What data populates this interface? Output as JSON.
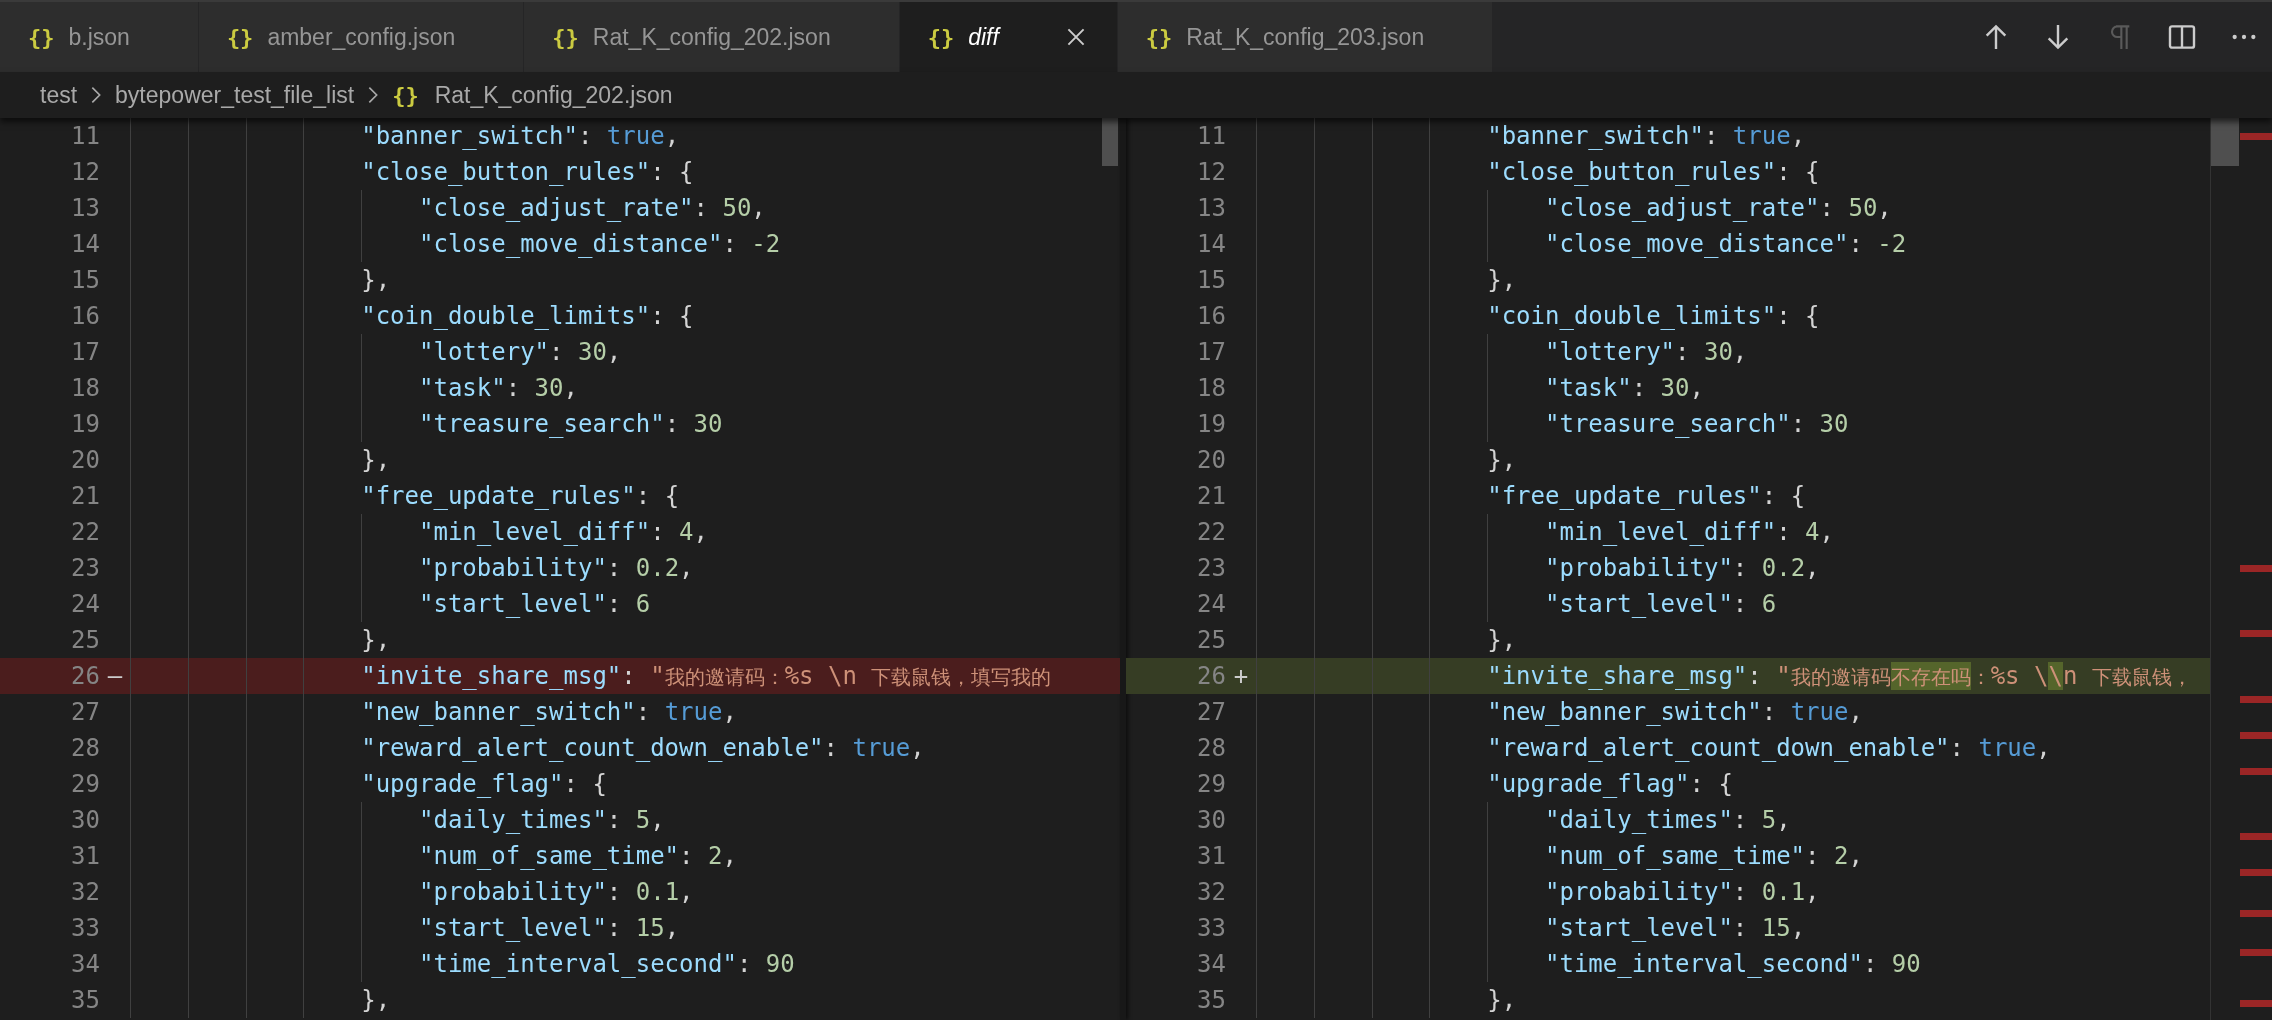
{
  "tabs": [
    {
      "icon": "{}",
      "label": "b.json",
      "selected": false,
      "preview": false
    },
    {
      "icon": "{}",
      "label": "amber_config.json",
      "selected": false,
      "preview": false
    },
    {
      "icon": "{}",
      "label": "Rat_K_config_202.json",
      "selected": false,
      "preview": false
    },
    {
      "icon": "{}",
      "label": "diff",
      "selected": true,
      "preview": true
    },
    {
      "icon": "{}",
      "label": "Rat_K_config_203.json",
      "selected": false,
      "preview": false
    }
  ],
  "toolbar": [
    {
      "kind": "previous-change",
      "disabled": false
    },
    {
      "kind": "next-change",
      "disabled": false
    },
    {
      "kind": "whitespace",
      "disabled": true
    },
    {
      "kind": "split",
      "disabled": false
    },
    {
      "kind": "more",
      "disabled": false
    }
  ],
  "breadcrumb": [
    {
      "label": "test"
    },
    {
      "label": "bytepower_test_file_list"
    },
    {
      "icon": "{}",
      "label": "Rat_K_config_202.json"
    }
  ],
  "diff": {
    "original": {
      "lines": [
        {
          "number": "11",
          "text": "                \"banner_switch\": true,"
        },
        {
          "number": "12",
          "text": "                \"close_button_rules\": {"
        },
        {
          "number": "13",
          "text": "                    \"close_adjust_rate\": 50,"
        },
        {
          "number": "14",
          "text": "                    \"close_move_distance\": -2"
        },
        {
          "number": "15",
          "text": "                },"
        },
        {
          "number": "16",
          "text": "                \"coin_double_limits\": {"
        },
        {
          "number": "17",
          "text": "                    \"lottery\": 30,"
        },
        {
          "number": "18",
          "text": "                    \"task\": 30,"
        },
        {
          "number": "19",
          "text": "                    \"treasure_search\": 30"
        },
        {
          "number": "20",
          "text": "                },"
        },
        {
          "number": "21",
          "text": "                \"free_update_rules\": {"
        },
        {
          "number": "22",
          "text": "                    \"min_level_diff\": 4,"
        },
        {
          "number": "23",
          "text": "                    \"probability\": 0.2,"
        },
        {
          "number": "24",
          "text": "                    \"start_level\": 6"
        },
        {
          "number": "25",
          "text": "                },"
        },
        {
          "number": "26",
          "marker": "—",
          "kind": "removed",
          "segments": [
            {
              "text": "                \"invite_share_msg\": \"我的邀请码：%s \\n 下载鼠钱，填写我的",
              "changed": false
            }
          ]
        },
        {
          "number": "27",
          "text": "                \"new_banner_switch\": true,"
        },
        {
          "number": "28",
          "text": "                \"reward_alert_count_down_enable\": true,"
        },
        {
          "number": "29",
          "text": "                \"upgrade_flag\": {"
        },
        {
          "number": "30",
          "text": "                    \"daily_times\": 5,"
        },
        {
          "number": "31",
          "text": "                    \"num_of_same_time\": 2,"
        },
        {
          "number": "32",
          "text": "                    \"probability\": 0.1,"
        },
        {
          "number": "33",
          "text": "                    \"start_level\": 15,"
        },
        {
          "number": "34",
          "text": "                    \"time_interval_second\": 90"
        },
        {
          "number": "35",
          "text": "                },"
        }
      ]
    },
    "modified": {
      "lines": [
        {
          "number": "11",
          "text": "                \"banner_switch\": true,"
        },
        {
          "number": "12",
          "text": "                \"close_button_rules\": {"
        },
        {
          "number": "13",
          "text": "                    \"close_adjust_rate\": 50,"
        },
        {
          "number": "14",
          "text": "                    \"close_move_distance\": -2"
        },
        {
          "number": "15",
          "text": "                },"
        },
        {
          "number": "16",
          "text": "                \"coin_double_limits\": {"
        },
        {
          "number": "17",
          "text": "                    \"lottery\": 30,"
        },
        {
          "number": "18",
          "text": "                    \"task\": 30,"
        },
        {
          "number": "19",
          "text": "                    \"treasure_search\": 30"
        },
        {
          "number": "20",
          "text": "                },"
        },
        {
          "number": "21",
          "text": "                \"free_update_rules\": {"
        },
        {
          "number": "22",
          "text": "                    \"min_level_diff\": 4,"
        },
        {
          "number": "23",
          "text": "                    \"probability\": 0.2,"
        },
        {
          "number": "24",
          "text": "                    \"start_level\": 6"
        },
        {
          "number": "25",
          "text": "                },"
        },
        {
          "number": "26",
          "marker": "+",
          "kind": "added",
          "segments": [
            {
              "text": "                \"invite_share_msg\": \"我的邀请码",
              "changed": false
            },
            {
              "text": "不存在吗",
              "changed": true
            },
            {
              "text": "：%s \\",
              "changed": false
            },
            {
              "text": "\\",
              "changed": true
            },
            {
              "text": "n 下载鼠钱，",
              "changed": false
            }
          ]
        },
        {
          "number": "27",
          "text": "                \"new_banner_switch\": true,"
        },
        {
          "number": "28",
          "text": "                \"reward_alert_count_down_enable\": true,"
        },
        {
          "number": "29",
          "text": "                \"upgrade_flag\": {"
        },
        {
          "number": "30",
          "text": "                    \"daily_times\": 5,"
        },
        {
          "number": "31",
          "text": "                    \"num_of_same_time\": 2,"
        },
        {
          "number": "32",
          "text": "                    \"probability\": 0.1,"
        },
        {
          "number": "33",
          "text": "                    \"start_level\": 15,"
        },
        {
          "number": "34",
          "text": "                    \"time_interval_second\": 90"
        },
        {
          "number": "35",
          "text": "                },"
        }
      ]
    }
  }
}
